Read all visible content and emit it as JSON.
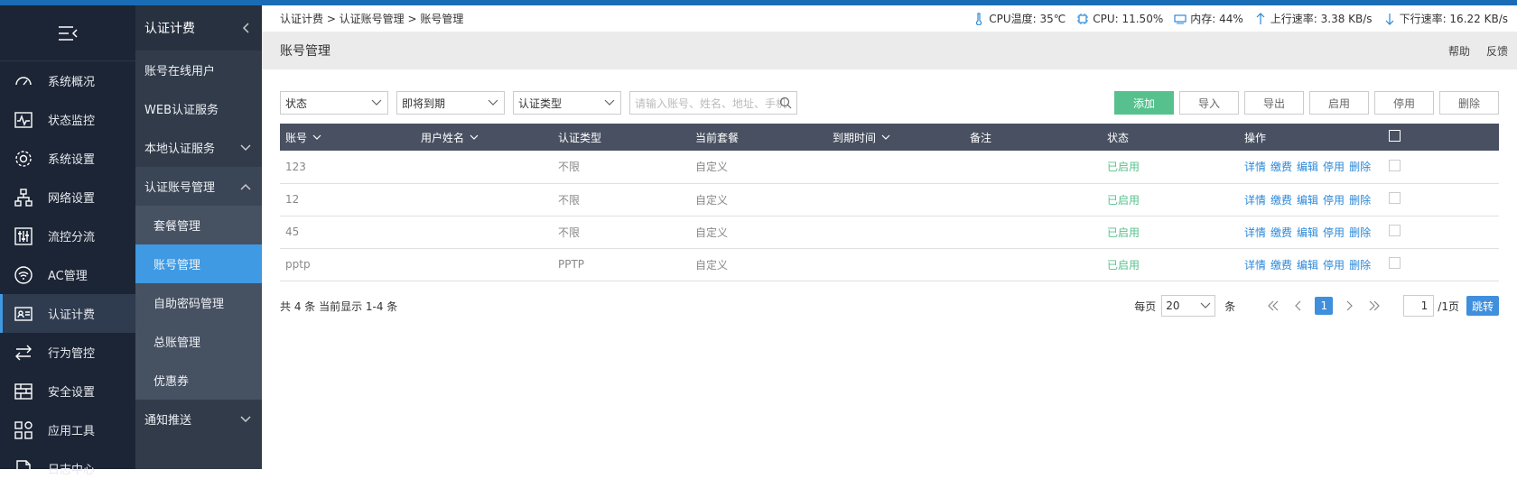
{
  "nav_primary": {
    "items": [
      {
        "label": "系统概况",
        "icon": "dashboard-icon"
      },
      {
        "label": "状态监控",
        "icon": "monitor-icon"
      },
      {
        "label": "系统设置",
        "icon": "gear-icon"
      },
      {
        "label": "网络设置",
        "icon": "network-icon"
      },
      {
        "label": "流控分流",
        "icon": "sliders-icon"
      },
      {
        "label": "AC管理",
        "icon": "wifi-icon"
      },
      {
        "label": "认证计费",
        "icon": "id-card-icon"
      },
      {
        "label": "行为管控",
        "icon": "swap-icon"
      },
      {
        "label": "安全设置",
        "icon": "firewall-icon"
      },
      {
        "label": "应用工具",
        "icon": "apps-icon"
      },
      {
        "label": "日志中心",
        "icon": "file-icon"
      }
    ]
  },
  "nav_secondary": {
    "title": "认证计费",
    "items": [
      {
        "label": "账号在线用户"
      },
      {
        "label": "WEB认证服务"
      },
      {
        "label": "本地认证服务"
      },
      {
        "label": "认证账号管理"
      },
      {
        "label": "套餐管理"
      },
      {
        "label": "账号管理"
      },
      {
        "label": "自助密码管理"
      },
      {
        "label": "总账管理"
      },
      {
        "label": "优惠券"
      },
      {
        "label": "通知推送"
      }
    ]
  },
  "breadcrumb": "认证计费 > 认证账号管理 > 账号管理",
  "stats": {
    "cpu_temp": "CPU温度: 35℃",
    "cpu": "CPU: 11.50%",
    "mem": "内存: 44%",
    "up": "上行速率: 3.38 KB/s",
    "down": "下行速率: 16.22 KB/s"
  },
  "page_title": "账号管理",
  "header_links": {
    "help": "帮助",
    "feedback": "反馈"
  },
  "filters": {
    "status": "状态",
    "expiring": "即将到期",
    "auth_type": "认证类型",
    "search_placeholder": "请输入账号、姓名、地址、手机"
  },
  "toolbar": {
    "add": "添加",
    "import": "导入",
    "export": "导出",
    "enable": "启用",
    "disable": "停用",
    "delete": "删除"
  },
  "table": {
    "headers": [
      "账号",
      "用户姓名",
      "认证类型",
      "当前套餐",
      "到期时间",
      "备注",
      "状态",
      "操作"
    ],
    "rows": [
      {
        "account": "123",
        "name": "",
        "type": "不限",
        "plan": "自定义",
        "expire": "",
        "note": "",
        "status": "已启用"
      },
      {
        "account": "12",
        "name": "",
        "type": "不限",
        "plan": "自定义",
        "expire": "",
        "note": "",
        "status": "已启用"
      },
      {
        "account": "45",
        "name": "",
        "type": "不限",
        "plan": "自定义",
        "expire": "",
        "note": "",
        "status": "已启用"
      },
      {
        "account": "pptp",
        "name": "",
        "type": "PPTP",
        "plan": "自定义",
        "expire": "",
        "note": "",
        "status": "已启用"
      }
    ],
    "ops": [
      "详情",
      "缴费",
      "编辑",
      "停用",
      "删除"
    ]
  },
  "footer": {
    "summary": "共 4 条 当前显示 1-4 条",
    "per_page_label": "每页",
    "per_page": "20",
    "per_page_unit": "条",
    "current_page": "1",
    "page_input": "1",
    "total_pages": "/1页",
    "go": "跳转"
  }
}
